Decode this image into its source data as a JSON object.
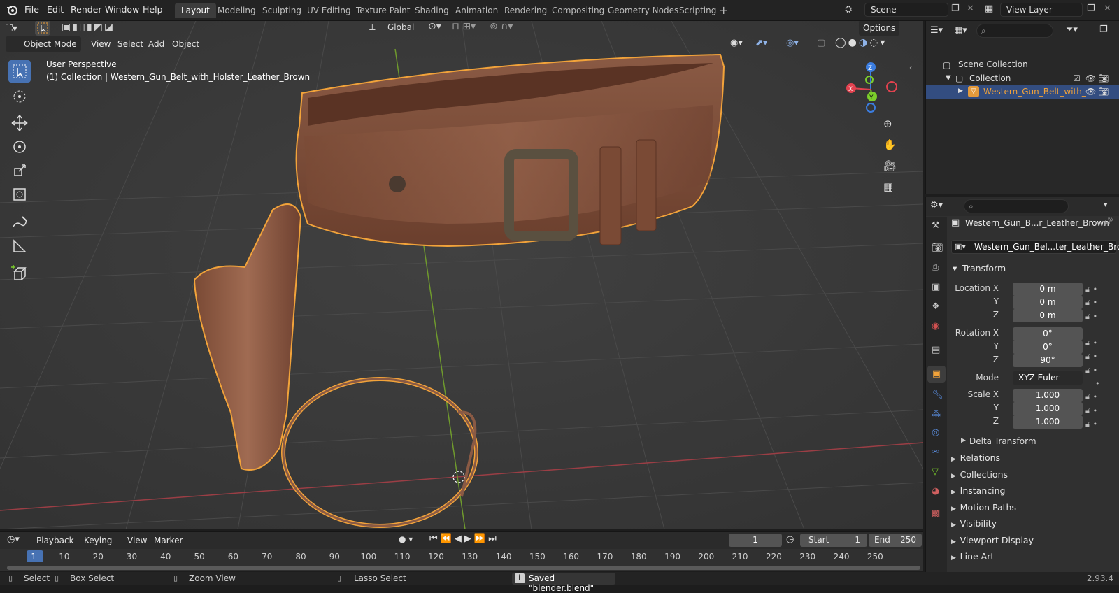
{
  "menus": [
    "File",
    "Edit",
    "Render",
    "Window",
    "Help"
  ],
  "workspaces": [
    "Layout",
    "Modeling",
    "Sculpting",
    "UV Editing",
    "Texture Paint",
    "Shading",
    "Animation",
    "Rendering",
    "Compositing",
    "Geometry Nodes",
    "Scripting"
  ],
  "scene_name": "Scene",
  "view_layer": "View Layer",
  "viewport": {
    "mode": "Object Mode",
    "menus": [
      "View",
      "Select",
      "Add",
      "Object"
    ],
    "orientation": "Global",
    "options": "Options",
    "perspective_label": "User Perspective",
    "collection_label": "(1) Collection | Western_Gun_Belt_with_Holster_Leather_Brown",
    "gizmo_axes": {
      "x": "X",
      "y": "Y",
      "z": "Z"
    }
  },
  "outliner": {
    "scene_collection": "Scene Collection",
    "collection": "Collection",
    "object": "Western_Gun_Belt_with_"
  },
  "properties": {
    "object_title": "Western_Gun_B...r_Leather_Brown",
    "object_name": "Western_Gun_Bel...ter_Leather_Brown",
    "transform": "Transform",
    "location": {
      "label_x": "Location X",
      "label_y": "Y",
      "label_z": "Z",
      "x": "0 m",
      "y": "0 m",
      "z": "0 m"
    },
    "rotation": {
      "label_x": "Rotation X",
      "label_y": "Y",
      "label_z": "Z",
      "x": "0°",
      "y": "0°",
      "z": "90°"
    },
    "mode_label": "Mode",
    "mode_value": "XYZ Euler",
    "scale": {
      "label_x": "Scale X",
      "label_y": "Y",
      "label_z": "Z",
      "x": "1.000",
      "y": "1.000",
      "z": "1.000"
    },
    "delta_transform": "Delta Transform",
    "sections": [
      "Relations",
      "Collections",
      "Instancing",
      "Motion Paths",
      "Visibility",
      "Viewport Display",
      "Line Art"
    ]
  },
  "timeline": {
    "menus": [
      "Playback",
      "Keying",
      "View",
      "Marker"
    ],
    "current_frame": "1",
    "start_label": "Start",
    "start": "1",
    "end_label": "End",
    "end": "250",
    "ticks": [
      "1",
      "10",
      "20",
      "30",
      "40",
      "50",
      "60",
      "70",
      "80",
      "90",
      "100",
      "110",
      "120",
      "130",
      "140",
      "150",
      "160",
      "170",
      "180",
      "190",
      "200",
      "210",
      "220",
      "230",
      "240",
      "250"
    ]
  },
  "status": {
    "select": "Select",
    "box_select": "Box Select",
    "zoom_view": "Zoom View",
    "lasso_select": "Lasso Select",
    "message": "Saved \"blender.blend\"",
    "version": "2.93.4"
  },
  "colors": {
    "accent": "#4772b3",
    "selection": "#f2a33a",
    "x_axis": "#e2424f",
    "y_axis": "#7ccf2b",
    "z_axis": "#3b7de0"
  }
}
